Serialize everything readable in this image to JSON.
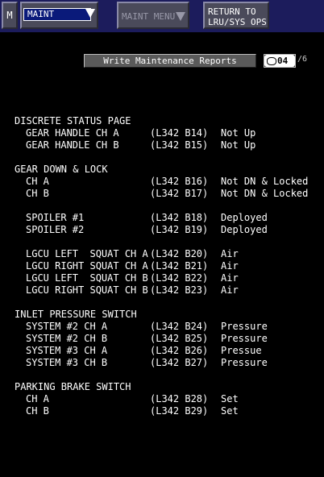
{
  "topbar": {
    "m_label": "M",
    "mode_value": "MAINT",
    "maint_menu_label": "MAINT MENU",
    "return_line1": "RETURN TO",
    "return_line2": "LRU/SYS OPS"
  },
  "toolbar": {
    "write_reports_label": "Write Maintenance Reports",
    "current_page": "04",
    "total_pages": "/6"
  },
  "report": {
    "sections": [
      {
        "title": "DISCRETE STATUS PAGE",
        "rows": [
          {
            "name": "GEAR HANDLE CH A",
            "pin": "(L342 B14)",
            "status": "Not Up"
          },
          {
            "name": "GEAR HANDLE CH B",
            "pin": "(L342 B15)",
            "status": "Not Up"
          }
        ]
      },
      {
        "title": "GEAR DOWN & LOCK",
        "rows": [
          {
            "name": "CH A",
            "pin": "(L342 B16)",
            "status": "Not DN & Locked"
          },
          {
            "name": "CH B",
            "pin": "(L342 B17)",
            "status": "Not DN & Locked"
          }
        ]
      },
      {
        "title": "",
        "rows": [
          {
            "name": "SPOILER #1",
            "pin": "(L342 B18)",
            "status": "Deployed"
          },
          {
            "name": "SPOILER #2",
            "pin": "(L342 B19)",
            "status": "Deployed"
          }
        ]
      },
      {
        "title": "",
        "rows": [
          {
            "name": "LGCU LEFT  SQUAT CH A",
            "pin": "(L342 B20)",
            "status": "Air"
          },
          {
            "name": "LGCU RIGHT SQUAT CH A",
            "pin": "(L342 B21)",
            "status": "Air"
          },
          {
            "name": "LGCU LEFT  SQUAT CH B",
            "pin": "(L342 B22)",
            "status": "Air"
          },
          {
            "name": "LGCU RIGHT SQUAT CH B",
            "pin": "(L342 B23)",
            "status": "Air"
          }
        ]
      },
      {
        "title": "INLET PRESSURE SWITCH",
        "rows": [
          {
            "name": "SYSTEM #2 CH A",
            "pin": "(L342 B24)",
            "status": "Pressure"
          },
          {
            "name": "SYSTEM #2 CH B",
            "pin": "(L342 B25)",
            "status": "Pressure"
          },
          {
            "name": "SYSTEM #3 CH A",
            "pin": "(L342 B26)",
            "status": "Pressue"
          },
          {
            "name": "SYSTEM #3 CH B",
            "pin": "(L342 B27)",
            "status": "Pressure"
          }
        ]
      },
      {
        "title": "PARKING BRAKE SWITCH",
        "rows": [
          {
            "name": "CH A",
            "pin": "(L342 B28)",
            "status": "Set"
          },
          {
            "name": "CH B",
            "pin": "(L342 B29)",
            "status": "Set"
          }
        ]
      }
    ]
  }
}
